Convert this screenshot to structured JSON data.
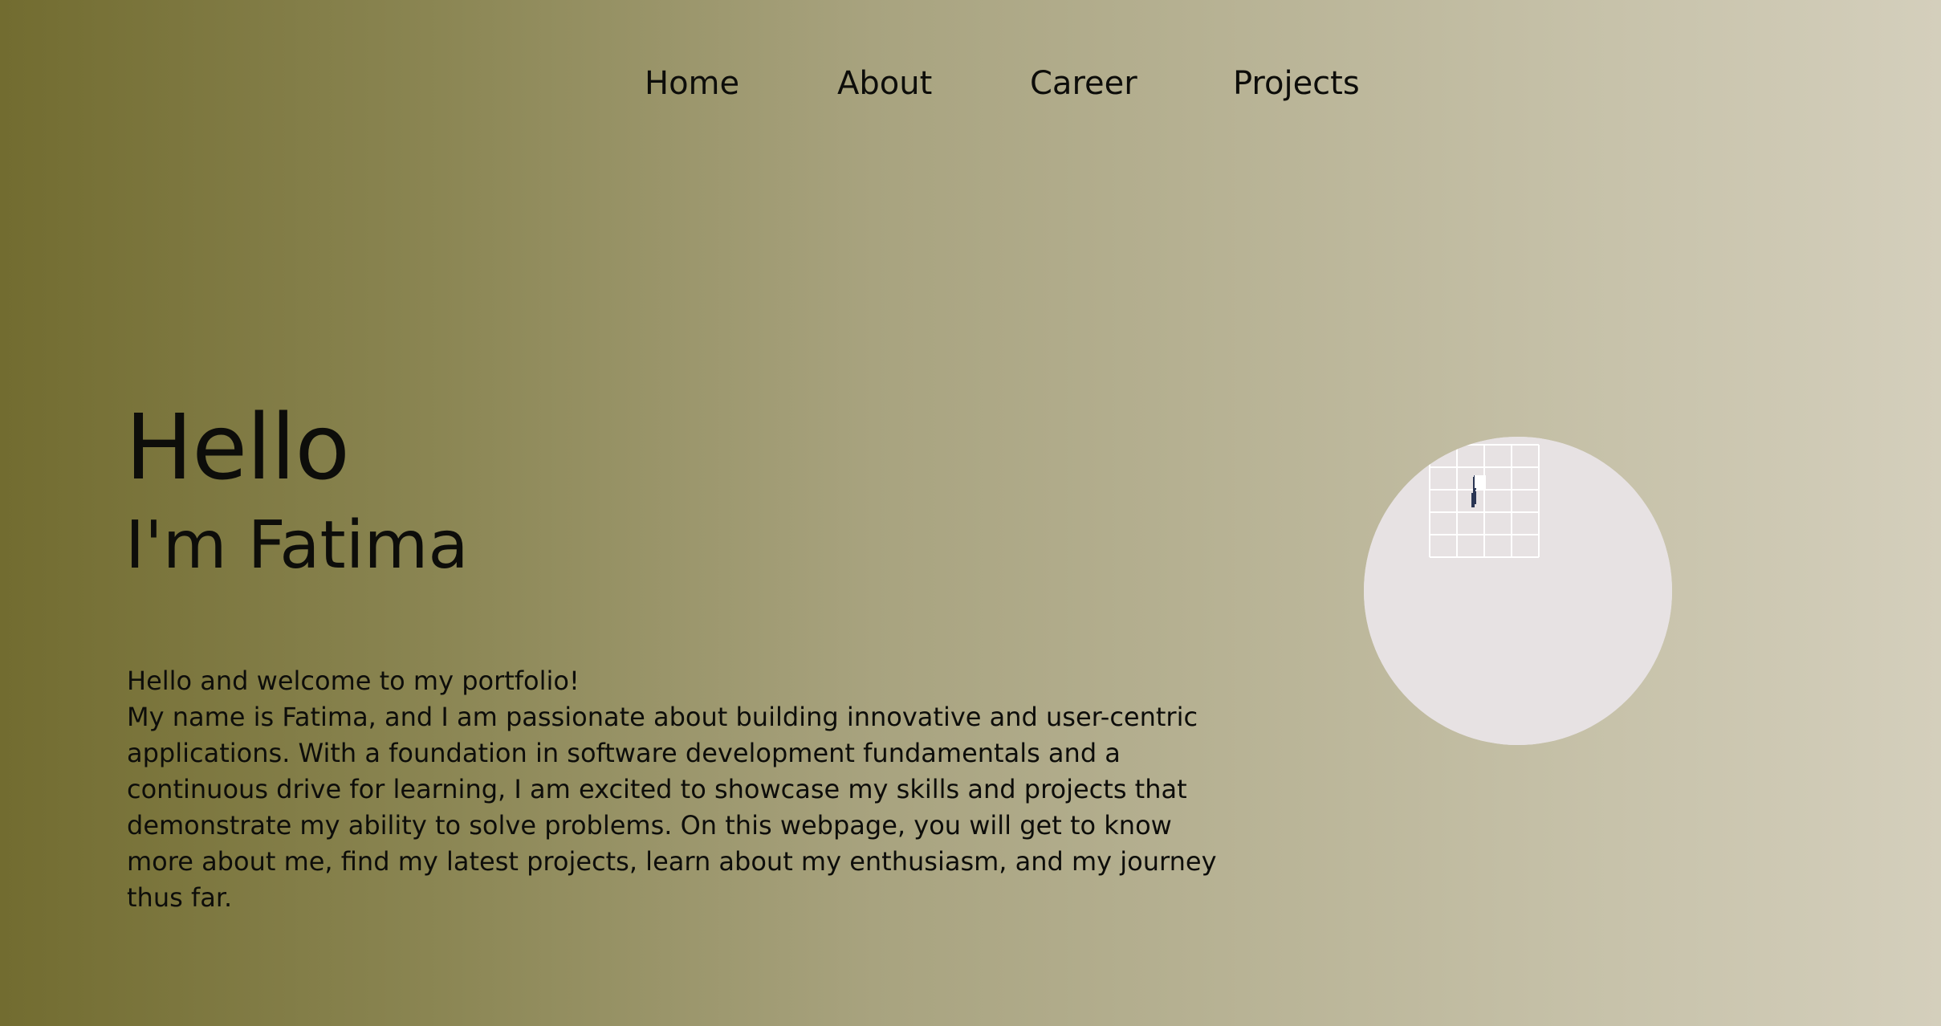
{
  "nav": {
    "items": [
      {
        "label": "Home"
      },
      {
        "label": "About"
      },
      {
        "label": "Career"
      },
      {
        "label": "Projects"
      }
    ]
  },
  "hero": {
    "title": "Hello",
    "subtitle": "I'm Fatima",
    "intro_greeting": "Hello and welcome to my portfolio!",
    "intro_body": "My name is Fatima, and I am passionate about building innovative and user-centric applications. With a foundation in software development fundamentals and a continuous drive for learning, I am excited to showcase my skills and projects that demonstrate my ability to solve problems. On this webpage, you will get to know more about me, find my latest projects, learn about my enthusiasm, and my journey thus far."
  },
  "illustration": {
    "icon": "developer-at-computer-illustration"
  },
  "colors": {
    "background_start": "#726c30",
    "background_end": "#d4cfbc",
    "text": "#0d0d0a",
    "hoodie": "#a9a5ef",
    "monitor": "#2a3553"
  }
}
